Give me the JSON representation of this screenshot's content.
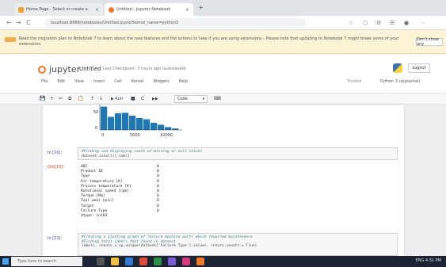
{
  "browser": {
    "tabs": [
      {
        "label": "Home Page - Select or create a",
        "active": false
      },
      {
        "label": "Untitled - Jupyter Notebook",
        "active": true
      }
    ],
    "new_tab": "+",
    "address": "localhost:8888/notebooks/Untitled.ipynb?kernel_name=python3",
    "nav": {
      "back": "←",
      "forward": "→",
      "reload": "C"
    }
  },
  "banner": {
    "message": "Read the migration plan to Notebook 7 to learn about the new features and the actions to take if you are using extensions - Please note that updating to Notebook 7 might break some of your extensions.",
    "dismiss_label": "Don't show any"
  },
  "jupyter": {
    "logo_text": "jupyter",
    "notebook_title": "Untitled",
    "checkpoint": "Last Checkpoint: 3 hours ago (autosaved)",
    "logout_label": "Logout",
    "menu": [
      "File",
      "Edit",
      "View",
      "Insert",
      "Cell",
      "Kernel",
      "Widgets",
      "Help"
    ],
    "trusted_label": "Trusted",
    "kernel_label": "Python 3 (ipykernel)",
    "toolbar": {
      "buttons": [
        "💾",
        "+",
        "✂",
        "⧉",
        "📋",
        "↑",
        "↓",
        "▶ Run",
        "■",
        "C",
        "▶▶"
      ],
      "cell_type": "Code",
      "keyboard_icon": "⌨"
    }
  },
  "histogram": {
    "ytick_top": "50",
    "ytick_bottom": "0",
    "xticks": [
      "0",
      "5000",
      "10000"
    ],
    "bar_heights": [
      0.98,
      0.55,
      0.7,
      0.72,
      0.6,
      0.5,
      0.45,
      0.3,
      0.22,
      0.12,
      0.06
    ]
  },
  "cells": [
    {
      "prompt": "In [10]:",
      "comment": "#Finding and displaying count of missing or null values",
      "code": "dataset.isnull().sum()"
    },
    {
      "prompt": "Out[10]:",
      "rows": [
        {
          "name": "UDI",
          "value": "0"
        },
        {
          "name": "Product ID",
          "value": "0"
        },
        {
          "name": "Type",
          "value": "0"
        },
        {
          "name": "Air temperature [K]",
          "value": "0"
        },
        {
          "name": "Process temperature [K]",
          "value": "0"
        },
        {
          "name": "Rotational speed [rpm]",
          "value": "0"
        },
        {
          "name": "Torque [Nm]",
          "value": "0"
        },
        {
          "name": "Tool wear [min]",
          "value": "0"
        },
        {
          "name": "Target",
          "value": "0"
        },
        {
          "name": "Failure Type",
          "value": "0"
        }
      ],
      "dtype": "dtype: int64"
    },
    {
      "prompt": "In [11]:",
      "comment": "#Creating a plotting graph of failure machine parts which required maintenance",
      "comment2": "#Finding total labels that found in dataset",
      "code": "labels, counts = np.unique(dataset['Failure Type'].values, return_counts = True)"
    }
  ],
  "taskbar": {
    "search_placeholder": "Type here to search",
    "clock": "ENG  4:31 PM"
  },
  "colors": {
    "bar": "#1f77b4",
    "jupyter_orange": "#f37726",
    "prompt_in": "#303f9f",
    "prompt_out": "#d84315"
  }
}
